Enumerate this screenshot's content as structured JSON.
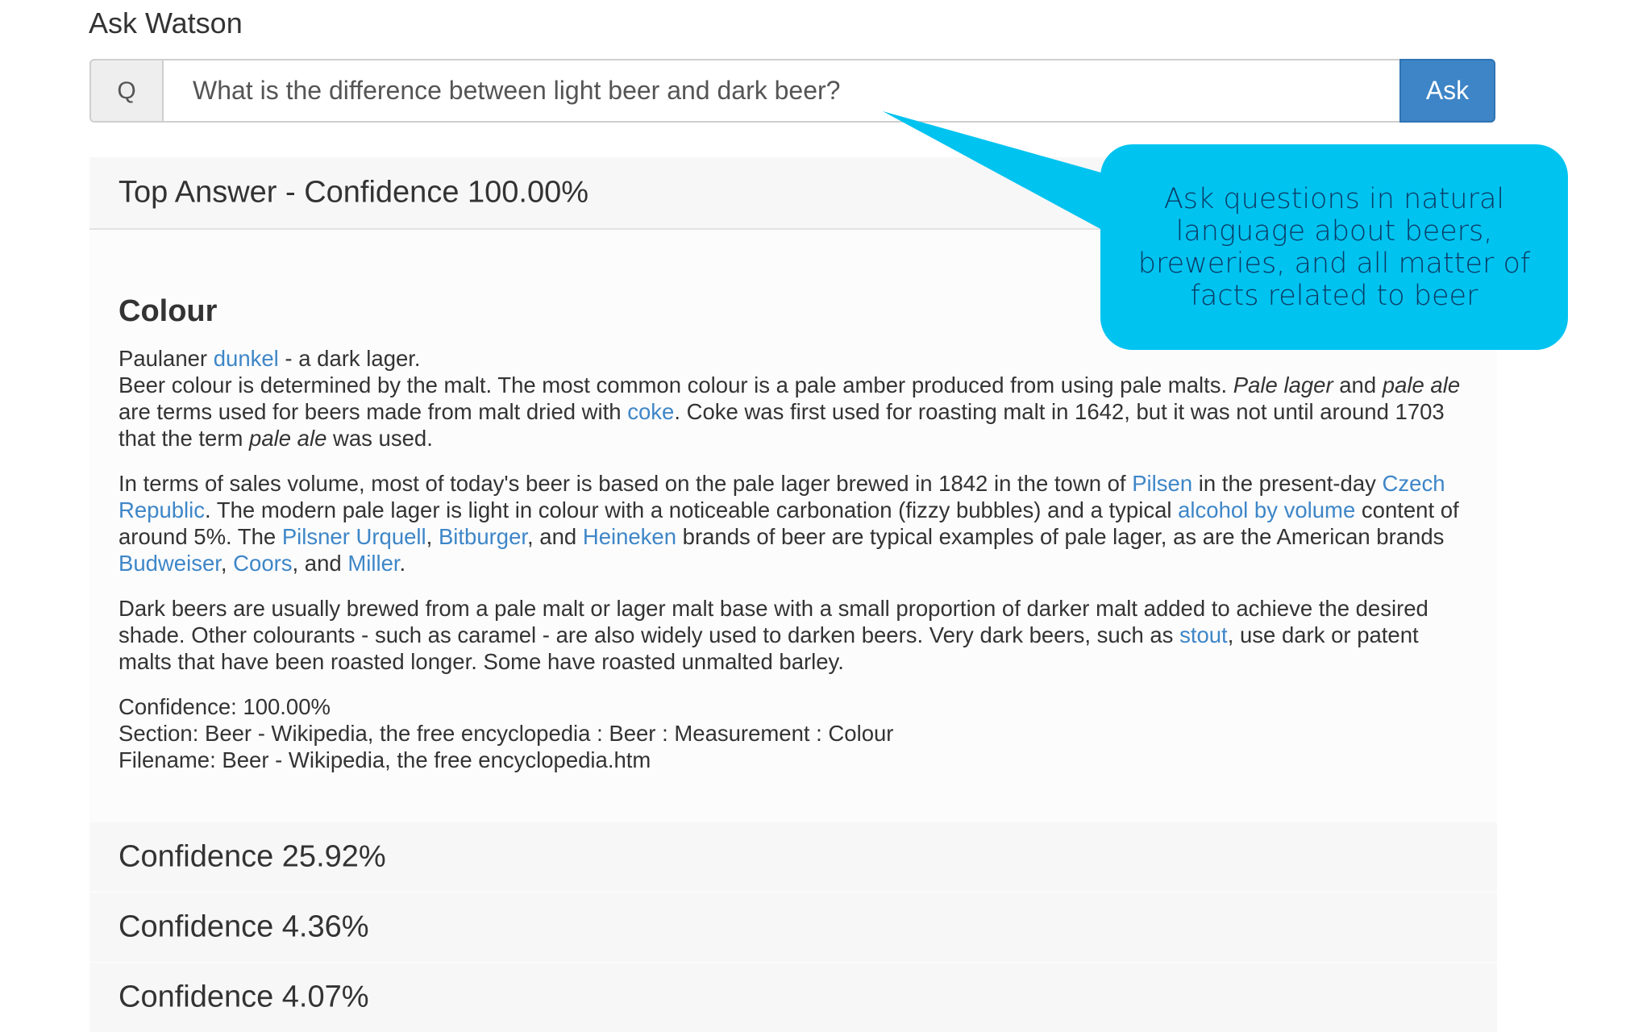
{
  "app": {
    "title": "Ask Watson"
  },
  "search": {
    "icon": "Q",
    "value": "What is the difference between light beer and dark beer?",
    "ask_label": "Ask"
  },
  "top_answer": {
    "heading": "Top Answer - Confidence 100.00%",
    "section_title": "Colour",
    "p1": {
      "a": "Paulaner ",
      "link_dunkel": "dunkel",
      "b": " - a dark lager.",
      "c": "Beer colour is determined by the malt. The most common colour is a pale amber produced from using pale malts. ",
      "em_pale_lager": "Pale lager",
      "d": " and ",
      "em_pale_ale": "pale ale",
      "e": " are terms used for beers made from malt dried with ",
      "link_coke": "coke",
      "f": ". Coke was first used for roasting malt in 1642, but it was not until around 1703 that the term ",
      "em_pale_ale2": "pale ale",
      "g": " was used."
    },
    "p2": {
      "a": "In terms of sales volume, most of today's beer is based on the pale lager brewed in 1842 in the town of ",
      "link_pilsen": "Pilsen",
      "b": " in the present-day ",
      "link_czech": "Czech Republic",
      "c": ". The modern pale lager is light in colour with a noticeable carbonation (fizzy bubbles) and a typical ",
      "link_abv": "alcohol by volume",
      "d": " content of around 5%. The ",
      "link_pilsner": "Pilsner Urquell",
      "e": ", ",
      "link_bitburger": "Bitburger",
      "f": ", and ",
      "link_heineken": "Heineken",
      "g": " brands of beer are typical examples of pale lager, as are the American brands ",
      "link_budweiser": "Budweiser",
      "h": ", ",
      "link_coors": "Coors",
      "i": ", and ",
      "link_miller": "Miller",
      "j": "."
    },
    "p3": {
      "a": "Dark beers are usually brewed from a pale malt or lager malt base with a small proportion of darker malt added to achieve the desired shade. Other colourants - such as caramel - are also widely used to darken beers. Very dark beers, such as ",
      "link_stout": "stout",
      "b": ", use dark or patent malts that have been roasted longer. Some have roasted unmalted barley."
    },
    "meta": {
      "confidence": "Confidence: 100.00%",
      "section": "Section: Beer - Wikipedia, the free encyclopedia : Beer : Measurement : Colour",
      "filename": "Filename: Beer - Wikipedia, the free encyclopedia.htm"
    }
  },
  "other_answers": [
    {
      "heading": "Confidence 25.92%"
    },
    {
      "heading": "Confidence 4.36%"
    },
    {
      "heading": "Confidence 4.07%"
    }
  ],
  "callout": {
    "text": "Ask questions in natural language about beers, breweries, and all matter of facts related to beer",
    "color": "#00c3f0"
  }
}
